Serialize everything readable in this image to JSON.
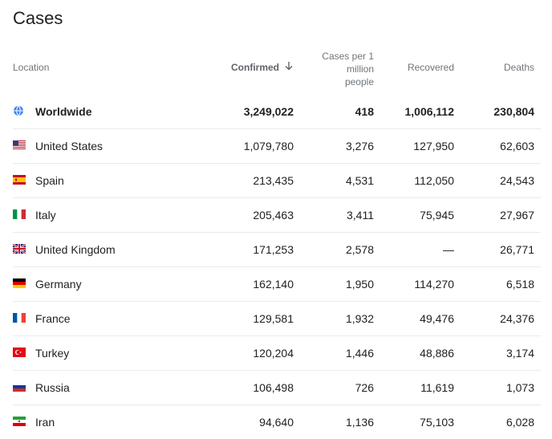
{
  "title": "Cases",
  "headers": {
    "location": "Location",
    "confirmed": "Confirmed",
    "per_million_1": "Cases per 1",
    "per_million_2": "million",
    "per_million_3": "people",
    "recovered": "Recovered",
    "deaths": "Deaths"
  },
  "rows": [
    {
      "location": "Worldwide",
      "confirmed": "3,249,022",
      "per_million": "418",
      "recovered": "1,006,112",
      "deaths": "230,804",
      "icon": "globe-icon"
    },
    {
      "location": "United States",
      "confirmed": "1,079,780",
      "per_million": "3,276",
      "recovered": "127,950",
      "deaths": "62,603",
      "icon": "us-flag-icon"
    },
    {
      "location": "Spain",
      "confirmed": "213,435",
      "per_million": "4,531",
      "recovered": "112,050",
      "deaths": "24,543",
      "icon": "spain-flag-icon"
    },
    {
      "location": "Italy",
      "confirmed": "205,463",
      "per_million": "3,411",
      "recovered": "75,945",
      "deaths": "27,967",
      "icon": "italy-flag-icon"
    },
    {
      "location": "United Kingdom",
      "confirmed": "171,253",
      "per_million": "2,578",
      "recovered": "—",
      "deaths": "26,771",
      "icon": "uk-flag-icon"
    },
    {
      "location": "Germany",
      "confirmed": "162,140",
      "per_million": "1,950",
      "recovered": "114,270",
      "deaths": "6,518",
      "icon": "germany-flag-icon"
    },
    {
      "location": "France",
      "confirmed": "129,581",
      "per_million": "1,932",
      "recovered": "49,476",
      "deaths": "24,376",
      "icon": "france-flag-icon"
    },
    {
      "location": "Turkey",
      "confirmed": "120,204",
      "per_million": "1,446",
      "recovered": "48,886",
      "deaths": "3,174",
      "icon": "turkey-flag-icon"
    },
    {
      "location": "Russia",
      "confirmed": "106,498",
      "per_million": "726",
      "recovered": "11,619",
      "deaths": "1,073",
      "icon": "russia-flag-icon"
    },
    {
      "location": "Iran",
      "confirmed": "94,640",
      "per_million": "1,136",
      "recovered": "75,103",
      "deaths": "6,028",
      "icon": "iran-flag-icon"
    }
  ],
  "colors": {
    "accent": "#4285f4",
    "border": "#e8eaed",
    "header_text": "#70757a"
  }
}
